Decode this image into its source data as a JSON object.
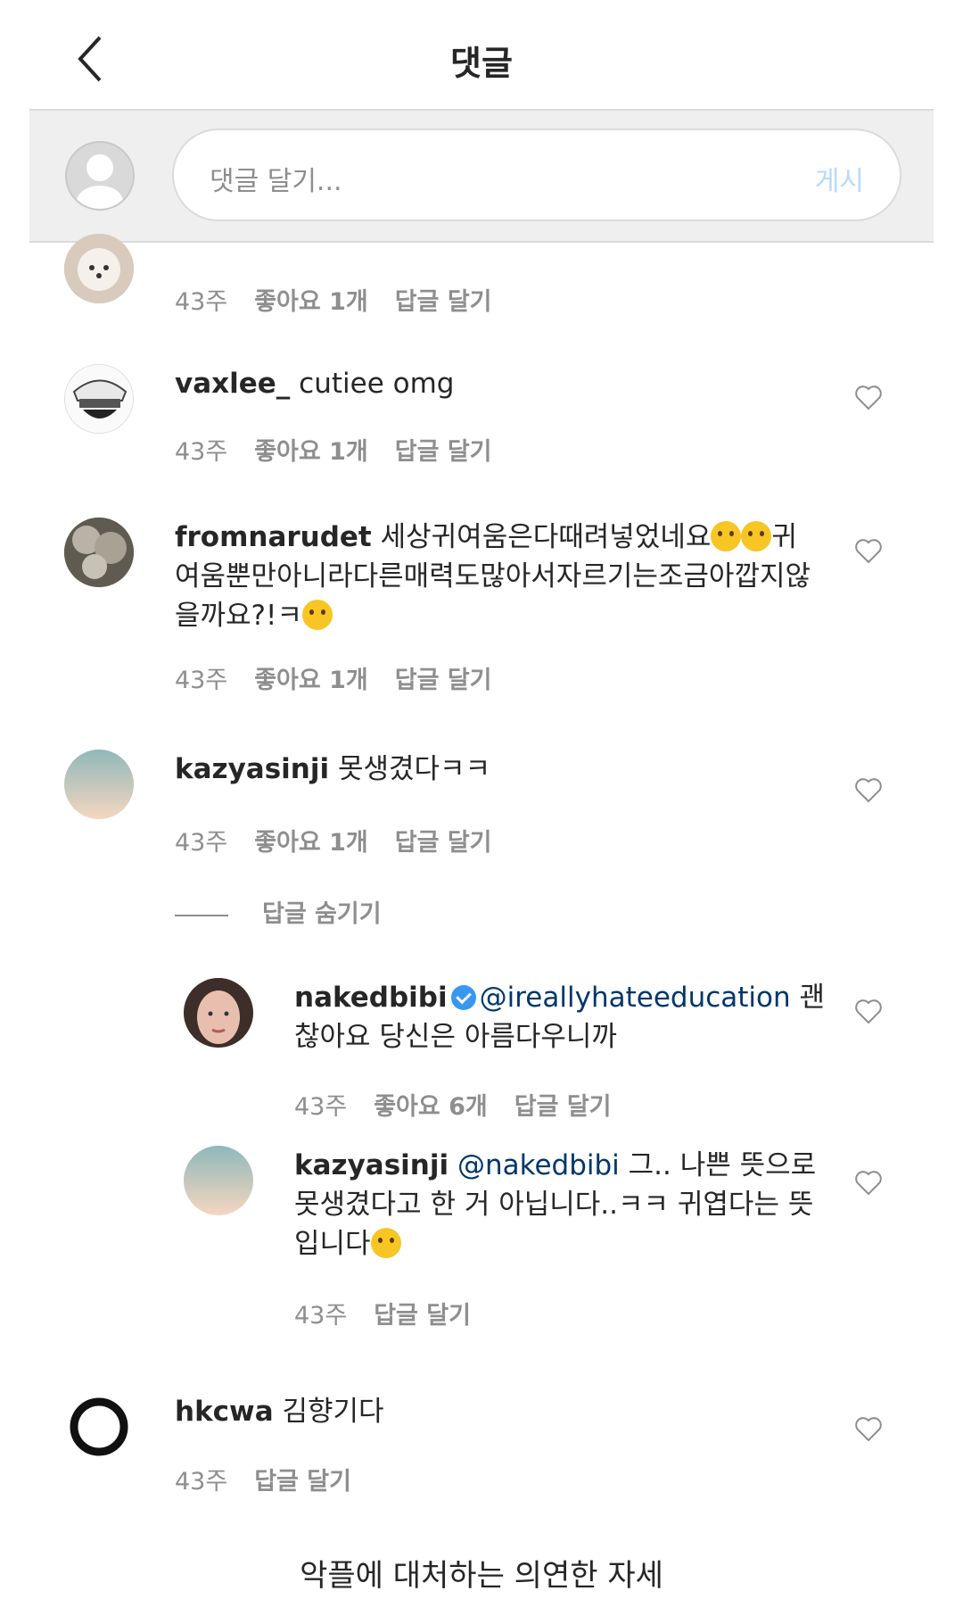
{
  "header": {
    "title": "댓글"
  },
  "composer": {
    "placeholder": "댓글 달기...",
    "post_label": "게시"
  },
  "comments": [
    {
      "username": "",
      "text": "",
      "time": "43주",
      "likes": "좋아요 1개",
      "reply": "답글 달기"
    },
    {
      "username": "vaxlee_",
      "text": "cutiee omg",
      "time": "43주",
      "likes": "좋아요 1개",
      "reply": "답글 달기"
    },
    {
      "username": "fromnarudet",
      "text_a": "세상귀여움은다때려넣었네요",
      "text_b": "귀여움뿐만아니라다른매력도많아서자르기는조금아깝지않을까요?!ㅋ",
      "time": "43주",
      "likes": "좋아요 1개",
      "reply": "답글 달기"
    },
    {
      "username": "kazyasinji",
      "text": "못생겼다ㅋㅋ",
      "time": "43주",
      "likes": "좋아요 1개",
      "reply": "답글 달기"
    }
  ],
  "hide_replies": "답글 숨기기",
  "replies": [
    {
      "username": "nakedbibi",
      "mention": "@ireallyhateeducation",
      "text": " 괜찮아요 당신은 아름다우니까",
      "time": "43주",
      "likes": "좋아요 6개",
      "reply": "답글 달기"
    },
    {
      "username": "kazyasinji",
      "mention": "@nakedbibi",
      "text": " 그.. 나쁜 뜻으로 못생겼다고 한 거 아닙니다..ㅋㅋ 귀엽다는 뜻입니다",
      "time": "43주",
      "reply": "답글 달기"
    }
  ],
  "last_comment": {
    "username": "hkcwa",
    "text": "김향기다",
    "time": "43주",
    "reply": "답글 달기"
  },
  "caption": "악플에 대처하는 의연한 자세",
  "colors": {
    "verified": "#3897f0",
    "mention": "#00376b",
    "post_disabled": "#b3dbff"
  }
}
